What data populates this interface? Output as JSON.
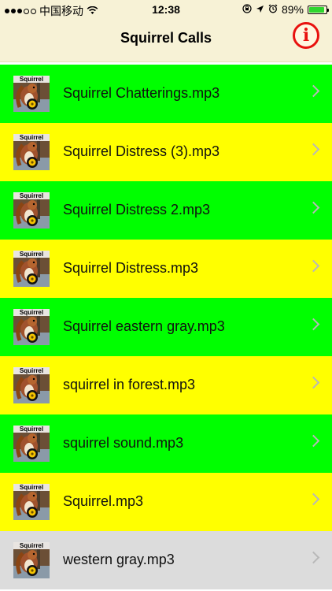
{
  "status_bar": {
    "carrier": "中国移动",
    "time": "12:38",
    "battery_percent": "89%",
    "battery_level": 0.89,
    "icons": [
      "wifi-icon",
      "orientation-lock-icon",
      "location-icon",
      "alarm-icon",
      "battery-icon"
    ]
  },
  "header": {
    "title": "Squirrel Calls",
    "info_glyph": "i",
    "info_icon": "info-icon"
  },
  "colors": {
    "header_bg": "#f7f2d6",
    "green_row": "#00ff00",
    "yellow_row": "#ffff00",
    "gray_row": "#dcdcdc",
    "info_red": "#e8110e"
  },
  "list": {
    "thumb_caption": "Squirrel",
    "items": [
      {
        "label": "Squirrel Chatterings.mp3",
        "bg": "#00ff00"
      },
      {
        "label": "Squirrel Distress (3).mp3",
        "bg": "#ffff00"
      },
      {
        "label": "Squirrel Distress 2.mp3",
        "bg": "#00ff00"
      },
      {
        "label": "Squirrel Distress.mp3",
        "bg": "#ffff00"
      },
      {
        "label": "Squirrel eastern gray.mp3",
        "bg": "#00ff00"
      },
      {
        "label": "squirrel in forest.mp3",
        "bg": "#ffff00"
      },
      {
        "label": "squirrel sound.mp3",
        "bg": "#00ff00"
      },
      {
        "label": "Squirrel.mp3",
        "bg": "#ffff00"
      },
      {
        "label": "western gray.mp3",
        "bg": "#dcdcdc"
      }
    ]
  }
}
